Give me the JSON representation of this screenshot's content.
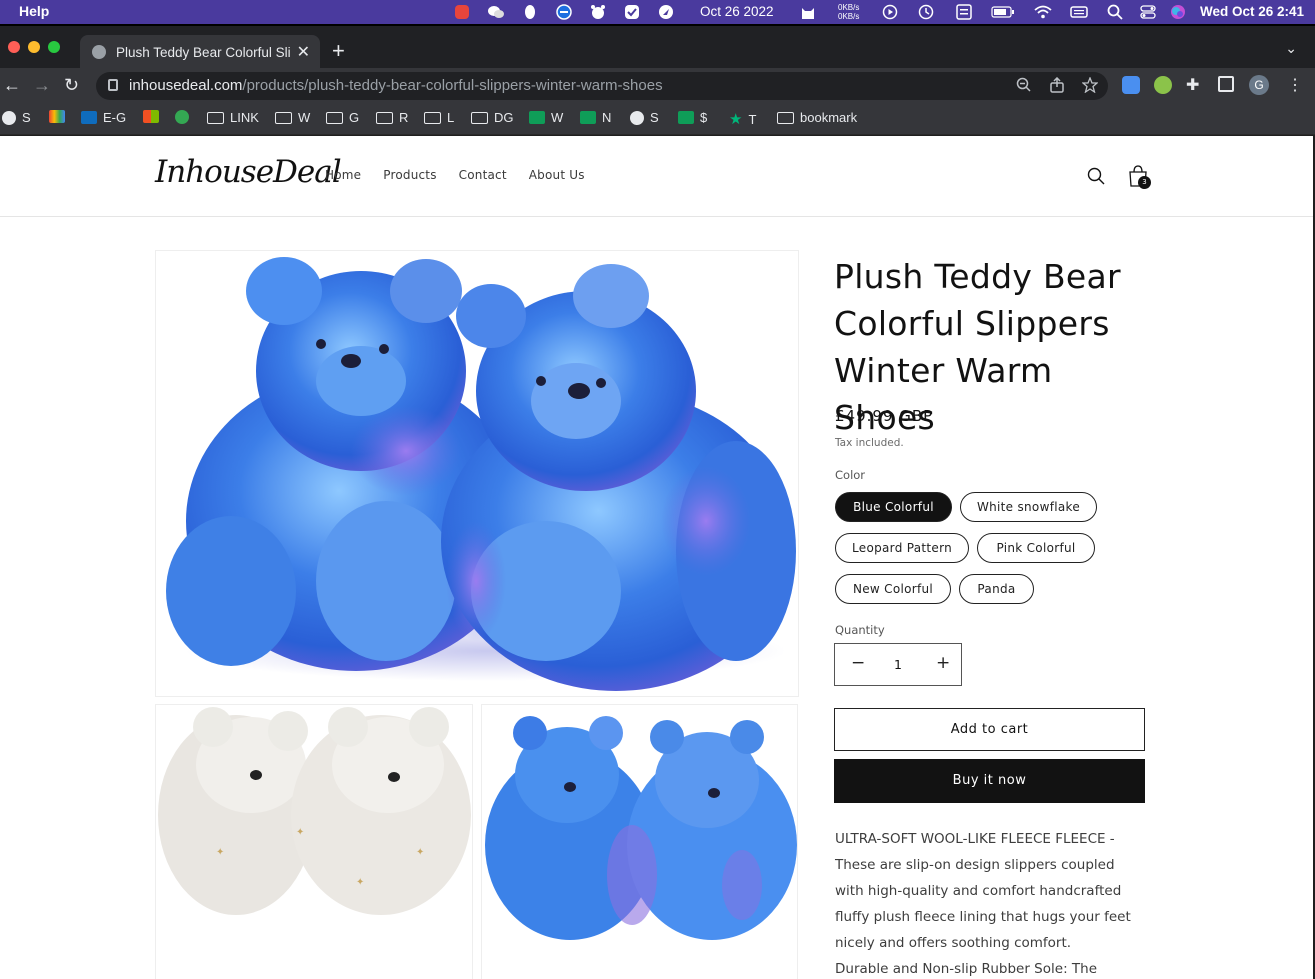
{
  "menubar": {
    "app_menu": "Help",
    "date_short": "Oct 26 2022",
    "net_up": "0KB/s",
    "net_down": "0KB/s",
    "clock": "Wed Oct 26  2:41"
  },
  "browser": {
    "tab_title": "Plush Teddy Bear Colorful Slippers Winter Warm Shoes",
    "url_host": "inhousedeal.com",
    "url_path": "/products/plush-teddy-bear-colorful-slippers-winter-warm-shoes",
    "profile_initial": "G",
    "bookmarks": [
      "S",
      "",
      "E-G",
      "",
      "",
      "LINK",
      "W",
      "G",
      "R",
      "L",
      "DG",
      "W",
      "N",
      "S",
      "$",
      "T",
      "bookmark"
    ]
  },
  "site": {
    "logo": "InhouseDeal",
    "nav": [
      "Home",
      "Products",
      "Contact",
      "About Us"
    ],
    "cart_count": "3"
  },
  "product": {
    "title": "Plush Teddy Bear Colorful Slippers Winter Warm Shoes",
    "price": "£49.99 GBP",
    "tax_note": "Tax included.",
    "color_label": "Color",
    "colors": [
      "Blue Colorful",
      "White snowflake",
      "Leopard Pattern",
      "Pink Colorful",
      "New Colorful",
      "Panda"
    ],
    "selected_color": "Blue Colorful",
    "quantity_label": "Quantity",
    "quantity": "1",
    "add_to_cart": "Add to cart",
    "buy_now": "Buy it now",
    "description_1": "ULTRA-SOFT WOOL-LIKE FLEECE FLEECE - These are slip-on design slippers coupled with high-quality and comfort handcrafted fluffy plush fleece lining that hugs your feet nicely and offers soothing comfort.",
    "description_2": "Durable and Non-slip Rubber Sole: The"
  },
  "colors": {
    "menubar_bg": "#4a3a9e",
    "chrome_dark": "#202124",
    "chrome_mid": "#35363a",
    "bear_blue": "#3a7de0",
    "bear_purple": "#8a6fe0",
    "bear_white": "#e8e6e2"
  }
}
